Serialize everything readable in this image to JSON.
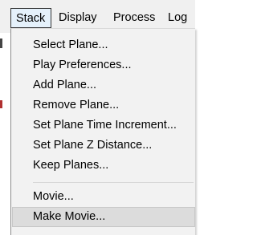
{
  "menubar": {
    "items": [
      {
        "label": "Stack",
        "active": true
      },
      {
        "label": "Display",
        "active": false
      },
      {
        "label": "Process",
        "active": false
      },
      {
        "label": "Log",
        "active": false
      }
    ]
  },
  "stack_menu": {
    "items": [
      {
        "label": "Select Plane..."
      },
      {
        "label": "Play Preferences..."
      },
      {
        "label": "Add Plane..."
      },
      {
        "label": "Remove Plane..."
      },
      {
        "label": "Set Plane Time Increment..."
      },
      {
        "label": "Set Plane Z Distance..."
      },
      {
        "label": "Keep Planes..."
      },
      {
        "label": "Movie..."
      },
      {
        "label": "Make Movie...",
        "highlighted": true
      }
    ]
  },
  "colors": {
    "menu_background": "#f2f2f2",
    "active_menu_background": "#e5f1fb",
    "highlight_background": "#dcdcdc"
  }
}
